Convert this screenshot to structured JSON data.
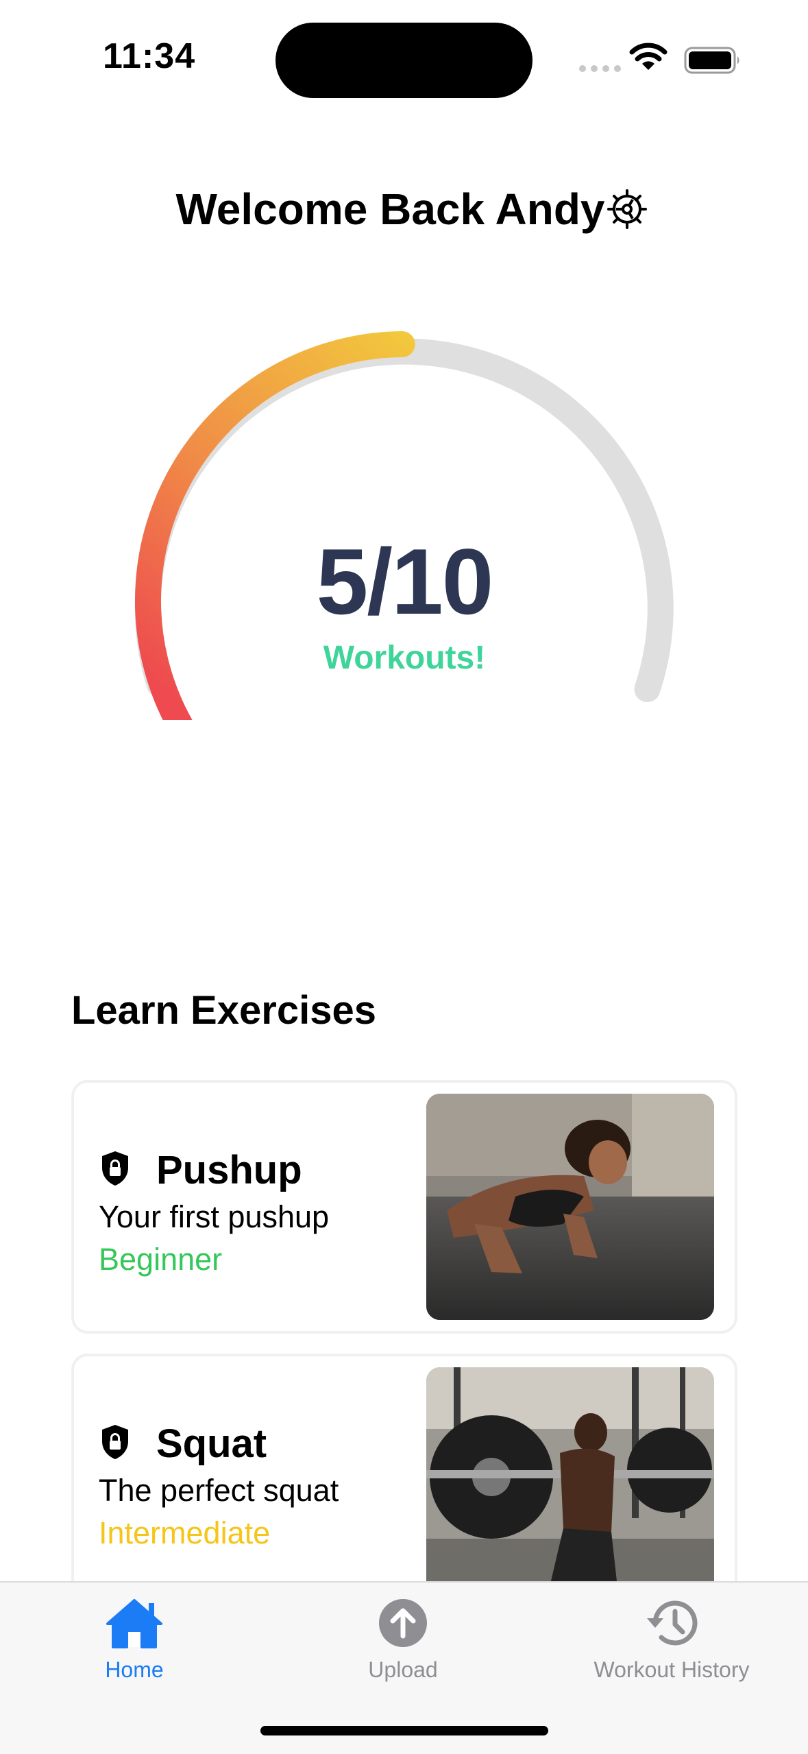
{
  "status_bar": {
    "time": "11:34"
  },
  "header": {
    "title": "Welcome Back Andy",
    "settings_icon": "gear-icon"
  },
  "progress": {
    "completed": 5,
    "goal": 10,
    "fraction": 0.5,
    "count_text": "5/10",
    "label": "Workouts!"
  },
  "learn": {
    "title": "Learn Exercises",
    "cards": [
      {
        "title": "Pushup",
        "subtitle": "Your first pushup",
        "level": "Beginner",
        "level_color": "#34c759",
        "icon": "shield-lock-icon"
      },
      {
        "title": "Squat",
        "subtitle": "The perfect squat",
        "level": "Intermediate",
        "level_color": "#f5c518",
        "icon": "shield-lock-icon"
      }
    ]
  },
  "tabs": [
    {
      "label": "Home",
      "icon": "house-icon",
      "selected": true
    },
    {
      "label": "Upload",
      "icon": "upload-arrow-icon",
      "selected": false
    },
    {
      "label": "Workout History",
      "icon": "history-clock-icon",
      "selected": false
    }
  ],
  "colors": {
    "accent": "#1b7cf5",
    "gauge_start": "#ee4a4f",
    "gauge_end": "#f2cd3c",
    "count_text": "#2d3652",
    "workouts_label": "#3fd49a"
  }
}
